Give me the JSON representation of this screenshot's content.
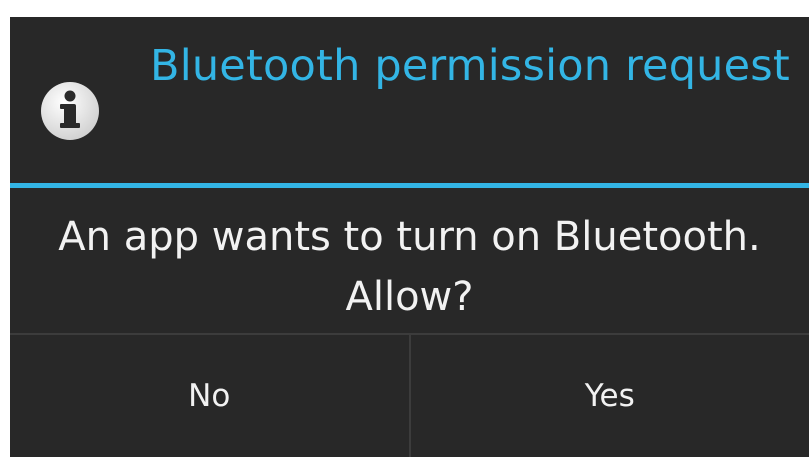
{
  "dialog": {
    "title": "Bluetooth permission request",
    "title_icon": "info-icon",
    "message": "An app wants to turn on Bluetooth. Allow?",
    "buttons": {
      "negative_label": "No",
      "positive_label": "Yes"
    }
  },
  "colors": {
    "accent": "#33b5e5",
    "dialog_background": "#282828",
    "text": "#f2f2f2"
  }
}
